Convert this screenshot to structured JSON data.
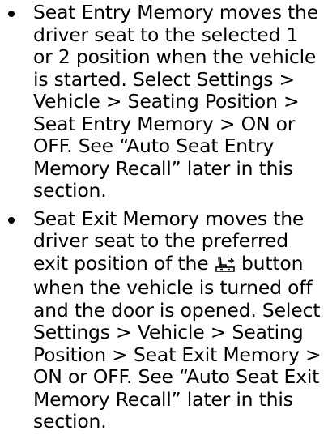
{
  "bullets": [
    {
      "text": "Seat Entry Memory moves the driver seat to the selected 1 or 2 position when the vehicle is started. Select Settings > Vehicle > Seating Position > Seat Entry Memory > ON or OFF. See “Auto Seat Entry Memory Recall” later in this section."
    },
    {
      "text_before_icon": "Seat Exit Memory moves the driver seat to the preferred exit position of the",
      "icon": "seat-exit-icon",
      "text_after_icon": "button when the vehicle is turned off and the door is opened. Select Settings > Vehicle > Seating Position > Seat Exit Memory > ON or OFF. See “Auto Seat Exit Memory Recall” later in this section."
    }
  ]
}
